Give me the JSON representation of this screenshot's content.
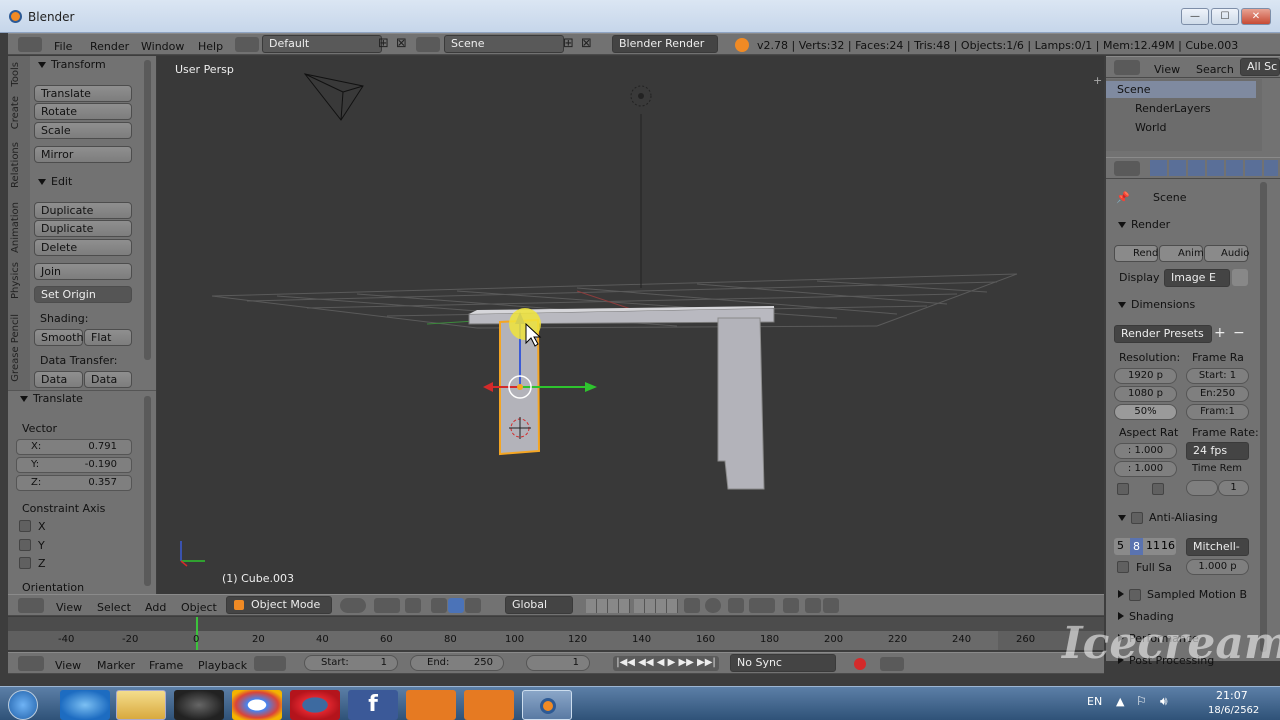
{
  "window": {
    "title": "Blender",
    "min": "—",
    "max": "☐",
    "close": "✕"
  },
  "info_bar": {
    "menus": [
      "File",
      "Render",
      "Window",
      "Help"
    ],
    "layout": "Default",
    "scene": "Scene",
    "engine": "Blender Render",
    "stats": "v2.78 | Verts:32 | Faces:24 | Tris:48 | Objects:1/6 | Lamps:0/1 | Mem:12.49M | Cube.003"
  },
  "left_tabs": [
    "Tools",
    "Create",
    "Relations",
    "Animation",
    "Physics",
    "Grease Pencil"
  ],
  "tools": {
    "transform_header": "Transform",
    "transform_buttons": [
      "Translate",
      "Rotate",
      "Scale"
    ],
    "mirror": "Mirror",
    "edit_header": "Edit",
    "edit_buttons": [
      "Duplicate",
      "Duplicate Linked",
      "Delete"
    ],
    "join": "Join",
    "set_origin": "Set Origin",
    "shading_label": "Shading:",
    "smooth": "Smooth",
    "flat": "Flat",
    "data_transfer_label": "Data Transfer:",
    "data": "Data",
    "data_la": "Data La"
  },
  "operator": {
    "header": "Translate",
    "vector_label": "Vector",
    "x_label": "X:",
    "x": "0.791",
    "y_label": "Y:",
    "y": "-0.190",
    "z_label": "Z:",
    "z": "0.357",
    "constraint_label": "Constraint Axis",
    "cx": "X",
    "cy": "Y",
    "cz": "Z",
    "orientation": "Orientation"
  },
  "viewport": {
    "view_name": "User Persp",
    "object_label": "(1) Cube.003"
  },
  "view3d_header": {
    "items": [
      "View",
      "Select",
      "Add",
      "Object"
    ],
    "mode": "Object Mode",
    "orientation": "Global"
  },
  "timeline": {
    "ticks": [
      "-40",
      "-20",
      "0",
      "20",
      "40",
      "60",
      "80",
      "100",
      "120",
      "140",
      "160",
      "180",
      "200",
      "220",
      "240",
      "260"
    ],
    "items": [
      "View",
      "Marker",
      "Frame",
      "Playback"
    ],
    "start_label": "Start:",
    "start": "1",
    "end_label": "End:",
    "end": "250",
    "current": "1",
    "sync": "No Sync"
  },
  "outliner": {
    "view": "View",
    "search": "Search",
    "all": "All Sc",
    "rows": [
      "Scene",
      "RenderLayers",
      "World"
    ]
  },
  "properties": {
    "scene": "Scene",
    "render_header": "Render",
    "render_btns": [
      "Rend",
      "Anim",
      "Audio"
    ],
    "display_label": "Display",
    "display_value": "Image E",
    "dimensions_header": "Dimensions",
    "render_presets": "Render Presets",
    "resolution_label": "Resolution:",
    "frame_range_label": "Frame Ra",
    "res_x": "1920 p",
    "res_y": "1080 p",
    "res_pct": "50%",
    "start": "Start: 1",
    "end": "En:250",
    "frame": "Fram:1",
    "aspect_label": "Aspect Rat",
    "frame_rate_label": "Frame Rate:",
    "aspect_x": ": 1.000",
    "aspect_y": ": 1.000",
    "fps": "24 fps",
    "time_rem": "Time Rem",
    "time_one": "1",
    "aa_header": "Anti-Aliasing",
    "aa_samples": [
      "5",
      "8",
      "11",
      "16"
    ],
    "aa_filter": "Mitchell-",
    "full_sample": "Full Sa",
    "aa_size": "1.000 p",
    "sampled_motion": "Sampled Motion B",
    "shading": "Shading",
    "performance": "Performance",
    "post_processing": "Post Processing"
  },
  "tray": {
    "lang": "EN",
    "time": "21:07",
    "date": "18/6/2562"
  },
  "watermark": "Icecream",
  "colors": {
    "bg": "#393939",
    "panel": "#727272",
    "accent": "#f08a24",
    "selected_outline": "#f5a623",
    "axis_x": "#d42a2a",
    "axis_y": "#2ec42e"
  }
}
